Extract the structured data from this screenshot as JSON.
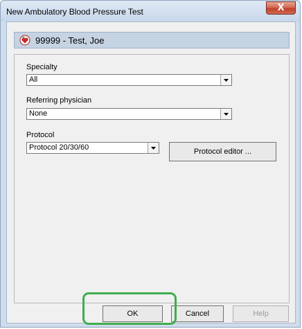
{
  "window": {
    "title": "New Ambulatory Blood Pressure Test",
    "close_glyph": "X"
  },
  "patient": {
    "label": "99999 - Test, Joe",
    "icon": "patient-heart-icon"
  },
  "specialty": {
    "label": "Specialty",
    "value": "All"
  },
  "referring": {
    "label": "Referring physician",
    "value": "None"
  },
  "protocol": {
    "label": "Protocol",
    "value": "Protocol 20/30/60",
    "editor_button": "Protocol editor ..."
  },
  "buttons": {
    "ok": "OK",
    "cancel": "Cancel",
    "help": "Help"
  },
  "colors": {
    "highlight": "#3fad4e",
    "header_bg": "#c6d3e3",
    "close_red": "#c0412c"
  }
}
